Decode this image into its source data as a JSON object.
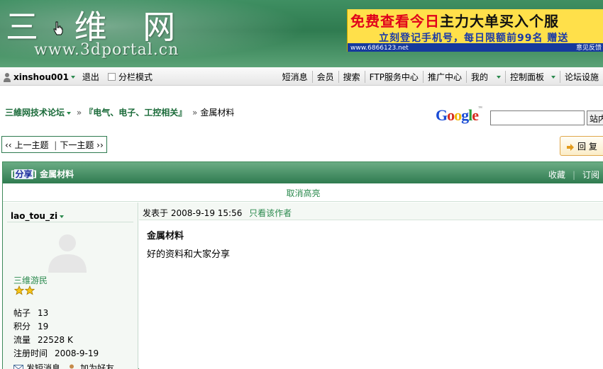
{
  "header": {
    "logo_text": "三 维 网",
    "logo_url_text": "www.3dportal.cn",
    "colors": {
      "header_green": "#2f7b50",
      "link_green": "#2b8a4e",
      "dark_green": "#1b6b3a"
    }
  },
  "ad": {
    "line1_red": "免费查看今日",
    "line1_black": "主力大单买入个服",
    "line2": "立刻登记手机号，每日限额前99名 赠送",
    "url": "www.6866123.net",
    "url_right": "意见反馈"
  },
  "userbar": {
    "username": "xinshou001",
    "logout": "退出",
    "column_mode": "分栏模式",
    "nav": [
      "短消息",
      "会员",
      "搜索",
      "FTP服务中心",
      "推广中心",
      "我的",
      "控制面板",
      "论坛设施"
    ]
  },
  "breadcrumb": {
    "forum": "三維网技术论坛",
    "section": "『电气、电子、工控相关』",
    "current": "金属材料"
  },
  "google": {
    "logo": "Google",
    "button": "站内"
  },
  "thread_nav": {
    "prev": "上一主题",
    "next": "下一主题",
    "reply": "回 复"
  },
  "thread": {
    "tag": "分享",
    "title": "金属材料",
    "favorite": "收藏",
    "subscribe": "订阅",
    "cancel_highlight": "取消高亮"
  },
  "author": {
    "name": "lao_tou_zi",
    "rank": "三维游民",
    "star_count": 2,
    "stats": [
      {
        "label": "帖子",
        "value": "13"
      },
      {
        "label": "积分",
        "value": "19"
      },
      {
        "label": "流量",
        "value": "22528 K"
      },
      {
        "label": "注册时间",
        "value": "2008-9-19"
      }
    ],
    "send_message": "发短消息",
    "add_friend": "加为好友"
  },
  "post": {
    "posted_label": "发表于",
    "posted_time": "2008-9-19 15:56",
    "only_author": "只看该作者",
    "subject": "金属材料",
    "body": "好的资料和大家分享"
  }
}
